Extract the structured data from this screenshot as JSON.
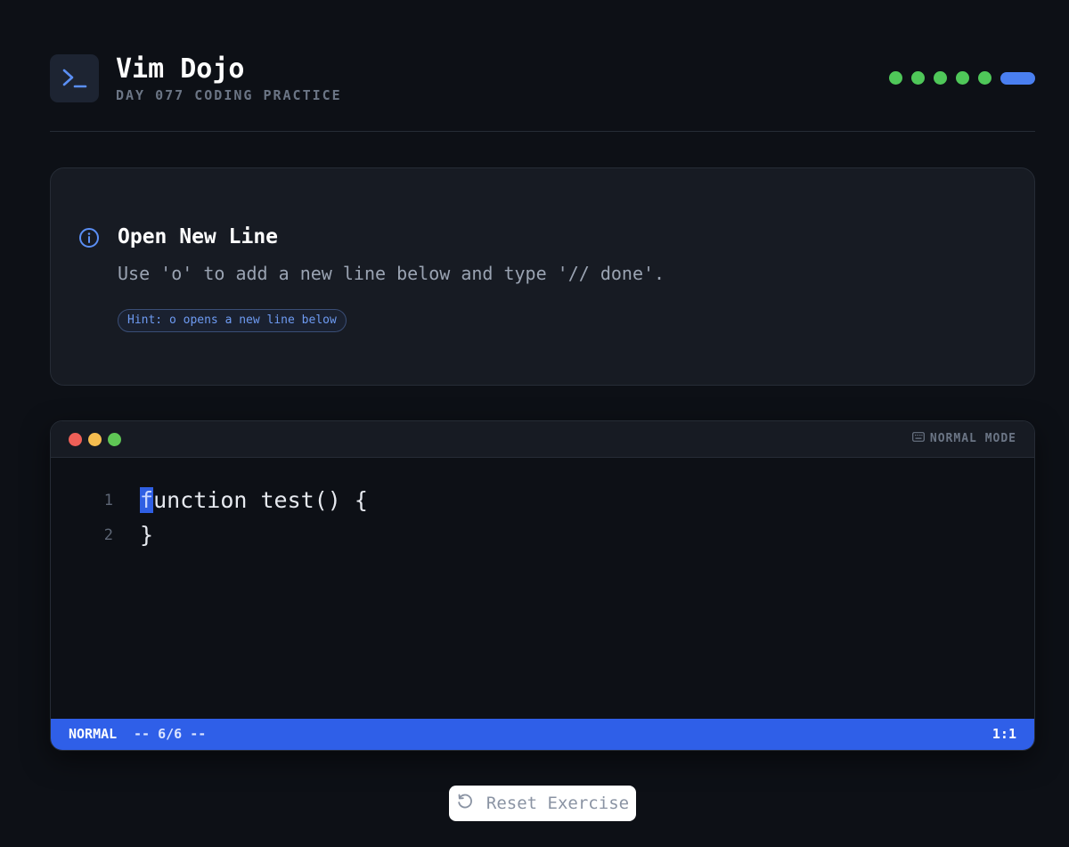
{
  "header": {
    "title": "Vim Dojo",
    "subtitle": "DAY 077 CODING PRACTICE",
    "logo_icon": "terminal-prompt-icon",
    "progress": {
      "completed": 5,
      "current": 6,
      "total": 6
    },
    "colors": {
      "done": "#4fc759",
      "current": "#4a7ff0"
    }
  },
  "task": {
    "icon": "info-icon",
    "title": "Open New Line",
    "description": "Use 'o' to add a new line below and type '// done'.",
    "hint": "Hint: o opens a new line below"
  },
  "editor": {
    "mode_label": "NORMAL MODE",
    "mode_icon": "keyboard-icon",
    "lines": [
      {
        "number": "1",
        "cursor_char": "f",
        "rest": "unction test() {"
      },
      {
        "number": "2",
        "text": "}"
      }
    ],
    "status": {
      "mode": "NORMAL",
      "info": "-- 6/6 --",
      "position": "1:1"
    },
    "accent": "#2f5fe8"
  },
  "actions": {
    "reset_label": "Reset Exercise",
    "reset_icon": "rotate-ccw-icon"
  }
}
